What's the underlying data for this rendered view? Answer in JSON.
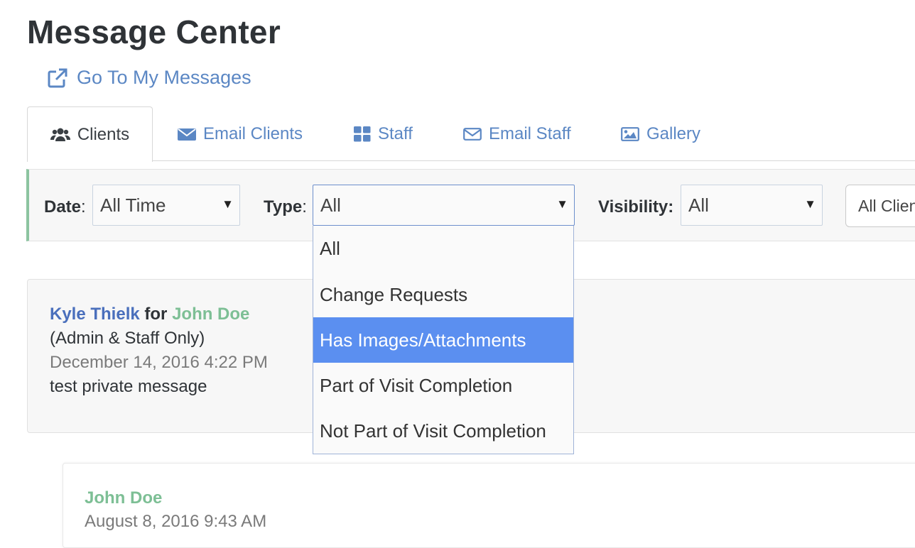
{
  "page": {
    "title": "Message Center"
  },
  "goto_link": {
    "label": "Go To My Messages",
    "icon": "external-link-icon"
  },
  "tabs": [
    {
      "label": "Clients",
      "icon": "users-icon",
      "active": true
    },
    {
      "label": "Email Clients",
      "icon": "envelope-icon",
      "active": false
    },
    {
      "label": "Staff",
      "icon": "grid-icon",
      "active": false
    },
    {
      "label": "Email Staff",
      "icon": "envelope-outline-icon",
      "active": false
    },
    {
      "label": "Gallery",
      "icon": "image-icon",
      "active": false
    }
  ],
  "filters": {
    "date": {
      "label": "Date",
      "value": "All Time"
    },
    "type": {
      "label": "Type",
      "value": "All",
      "options": [
        "All",
        "Change Requests",
        "Has Images/Attachments",
        "Part of Visit Completion",
        "Not Part of Visit Completion"
      ],
      "highlighted": "Has Images/Attachments"
    },
    "visibility": {
      "label": "Visibility",
      "value": "All"
    },
    "clients": {
      "value": "All Clients"
    }
  },
  "messages": [
    {
      "author": "Kyle Thielk",
      "connector": "for",
      "recipient": "John Doe",
      "visibility_note": "(Admin & Staff Only)",
      "timestamp": "December 14, 2016 4:22 PM",
      "body": "test private message"
    },
    {
      "author": "John Doe",
      "timestamp": "August 8, 2016 9:43 AM"
    }
  ],
  "colors": {
    "link": "#5b87c4",
    "author": "#4a6fbc",
    "client": "#7dbf95",
    "highlight": "#5b8ff0",
    "accent_bar": "#8cc4a0"
  }
}
